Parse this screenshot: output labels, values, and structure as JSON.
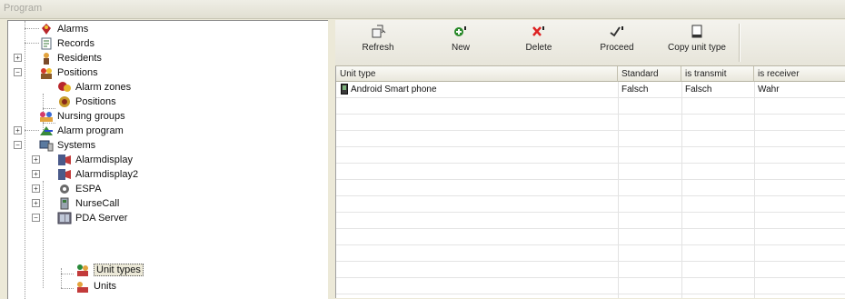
{
  "window": {
    "title": "Program"
  },
  "tree": {
    "items": [
      {
        "label": "Alarms"
      },
      {
        "label": "Records"
      },
      {
        "label": "Residents"
      },
      {
        "label": "Positions"
      },
      {
        "label": "Alarm zones"
      },
      {
        "label": "Positions"
      },
      {
        "label": "Nursing groups"
      },
      {
        "label": "Alarm program"
      },
      {
        "label": "Systems"
      },
      {
        "label": "Alarmdisplay"
      },
      {
        "label": "Alarmdisplay2"
      },
      {
        "label": "ESPA"
      },
      {
        "label": "NurseCall"
      },
      {
        "label": "PDA Server"
      },
      {
        "label": "Unit types"
      },
      {
        "label": "Units"
      }
    ]
  },
  "toolbar": {
    "refresh": "Refresh",
    "new": "New",
    "delete": "Delete",
    "proceed": "Proceed",
    "copy": "Copy unit type"
  },
  "table": {
    "columns": [
      "Unit type",
      "Standard",
      "is transmit",
      "is receiver"
    ],
    "rows": [
      {
        "unit_type": "Android Smart phone",
        "standard": "Falsch",
        "is_transmit": "Falsch",
        "is_receiver": "Wahr"
      }
    ]
  }
}
